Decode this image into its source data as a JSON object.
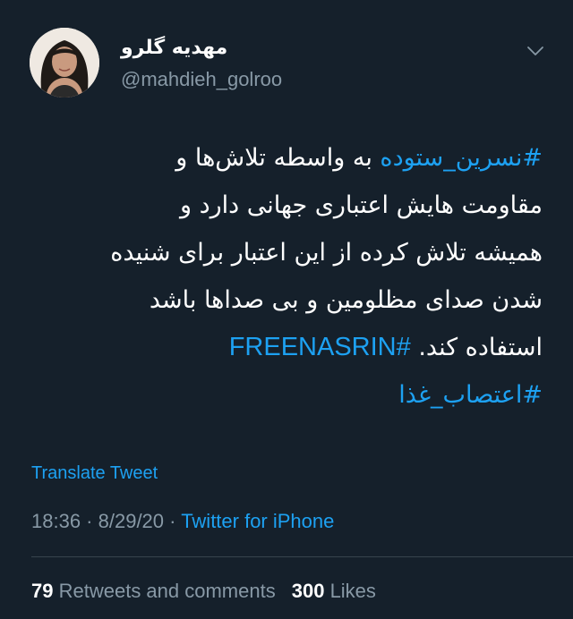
{
  "tweet": {
    "author": {
      "display_name": "مهدیه گلرو",
      "handle": "@mahdieh_golroo",
      "avatar_icon": "profile-photo"
    },
    "menu_icon": "chevron-down-icon",
    "body": {
      "line1_tag": "#نسرین_ستوده",
      "line1_text": " به واسطه تلاش‌ها و",
      "line2": "مقاومت هایش اعتباری جهانی دارد و",
      "line3": "همیشه تلاش کرده از این اعتبار برای شنیده",
      "line4": "شدن صدای مظلومین و بی صداها باشد",
      "line5_text": "استفاده کند. ",
      "line5_tag": "#FREENASRIN",
      "line6_tag": "#اعتصاب_غذا"
    },
    "translate_label": "Translate Tweet",
    "meta": {
      "time": "18:36",
      "date": "8/29/20",
      "separator": " · ",
      "source": "Twitter for iPhone"
    },
    "stats": {
      "retweets_count": "79",
      "retweets_label": "Retweets and comments",
      "likes_count": "300",
      "likes_label": "Likes"
    },
    "colors": {
      "background": "#15202b",
      "accent": "#1da1f2",
      "secondary_text": "#8899a6"
    }
  }
}
